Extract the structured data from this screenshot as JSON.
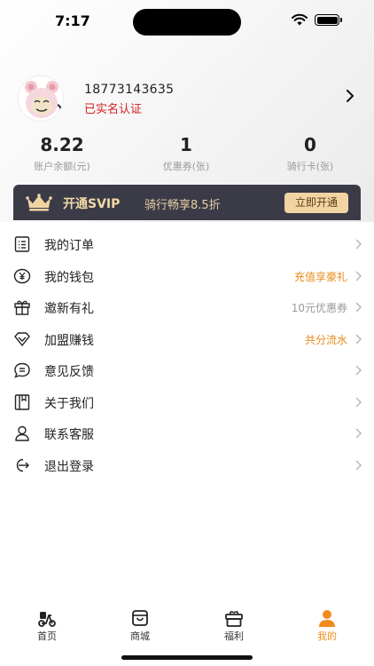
{
  "status_bar": {
    "time": "7:17"
  },
  "profile": {
    "phone": "18773143635",
    "verified_label": "已实名认证"
  },
  "stats": [
    {
      "value": "8.22",
      "label": "账户余额(元)"
    },
    {
      "value": "1",
      "label": "优惠券(张)"
    },
    {
      "value": "0",
      "label": "骑行卡(张)"
    }
  ],
  "svip": {
    "title": "开通SVIP",
    "subtitle": "骑行畅享8.5折",
    "button": "立即开通"
  },
  "menu": [
    {
      "label": "我的订单",
      "extra": ""
    },
    {
      "label": "我的钱包",
      "extra": "充值享豪礼"
    },
    {
      "label": "邀新有礼",
      "extra": "10元优惠券"
    },
    {
      "label": "加盟赚钱",
      "extra": "共分流水"
    },
    {
      "label": "意见反馈",
      "extra": ""
    },
    {
      "label": "关于我们",
      "extra": ""
    },
    {
      "label": "联系客服",
      "extra": ""
    },
    {
      "label": "退出登录",
      "extra": ""
    }
  ],
  "tabs": [
    {
      "label": "首页",
      "icon": "scooter-icon"
    },
    {
      "label": "商城",
      "icon": "shopping-bag-icon"
    },
    {
      "label": "福利",
      "icon": "gift-icon"
    },
    {
      "label": "我的",
      "icon": "person-icon",
      "active": true
    }
  ],
  "colors": {
    "accent": "#f08c1e",
    "verified": "#d32020",
    "svip_bg": "#3b3b48",
    "svip_gold": "#f2d4a3"
  }
}
